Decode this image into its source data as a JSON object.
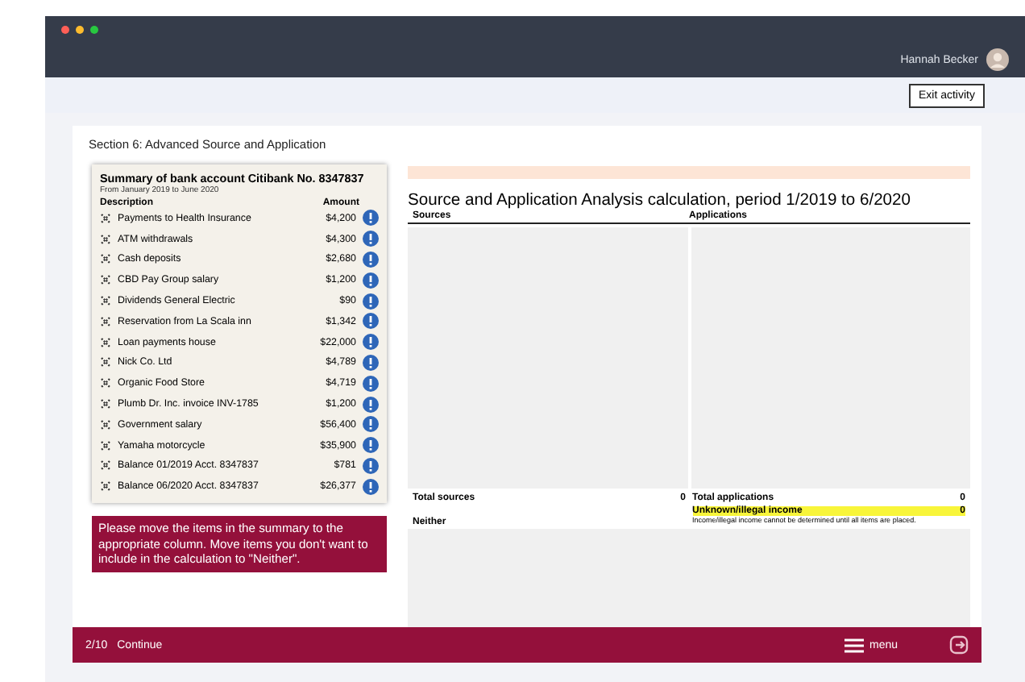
{
  "toolbar": {
    "user_name": "Hannah Becker",
    "button": "Exit activity"
  },
  "section_title": "Section 6: Advanced Source and Application",
  "summary": {
    "title": "Summary of bank account Citibank No. 8347837",
    "subtitle": "From January 2019 to June 2020",
    "columns": [
      "Description",
      "Amount"
    ],
    "items": [
      {
        "description": "Payments to Health Insurance",
        "amount": "$4,200"
      },
      {
        "description": "ATM withdrawals",
        "amount": "$4,300"
      },
      {
        "description": "Cash deposits",
        "amount": "$2,680"
      },
      {
        "description": "CBD Pay Group salary",
        "amount": "$1,200"
      },
      {
        "description": "Dividends General Electric",
        "amount": "$90"
      },
      {
        "description": "Reservation from La Scala inn",
        "amount": "$1,342"
      },
      {
        "description": "Loan payments house",
        "amount": "$22,000"
      },
      {
        "description": "Nick Co. Ltd",
        "amount": "$4,789"
      },
      {
        "description": "Organic Food Store",
        "amount": "$4,719"
      },
      {
        "description": "Plumb Dr. Inc. invoice INV-1785",
        "amount": "$1,200"
      },
      {
        "description": "Government salary",
        "amount": "$56,400"
      },
      {
        "description": "Yamaha motorcycle",
        "amount": "$35,900"
      },
      {
        "description": "Balance 01/2019 Acct. 8347837",
        "amount": "$781"
      },
      {
        "description": "Balance 06/2020 Acct. 8347837",
        "amount": "$26,377"
      }
    ]
  },
  "hint": "Please move the items in the summary to the appropriate column. Move items you don't want to include in the calculation to \"Neither\".",
  "analysis": {
    "title": "Source and Application Analysis calculation, period 1/2019 to 6/2020",
    "columns": [
      "Sources",
      "Applications"
    ],
    "total_sources": {
      "label": "Total sources",
      "value": "0"
    },
    "total_applications": {
      "label": "Total applications",
      "value": "0"
    },
    "unknown": {
      "label": "Unknown/illegal income",
      "value": "0"
    },
    "unknown_note": "Income/illegal income cannot be determined until all items are placed.",
    "neither": "Neither"
  },
  "footer": {
    "progress": "2/10",
    "label": "Continue",
    "menu": "menu"
  }
}
